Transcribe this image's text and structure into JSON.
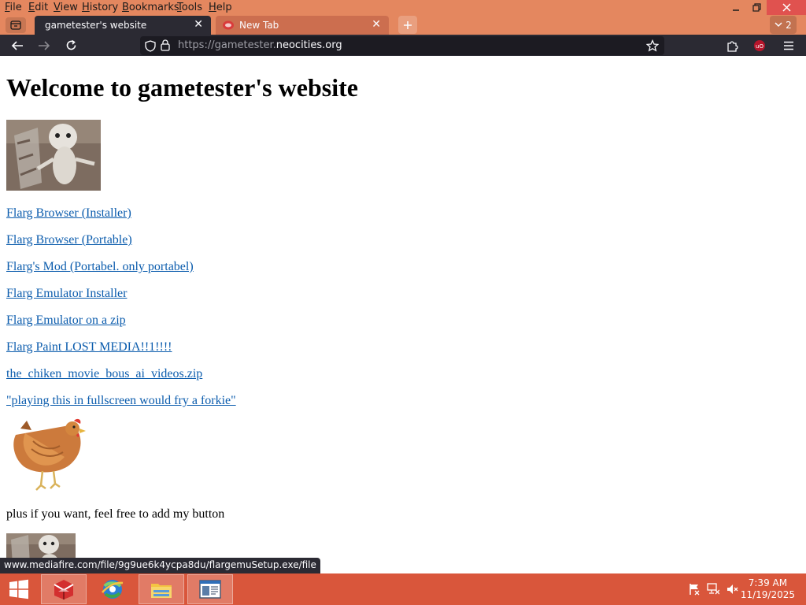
{
  "menubar": {
    "items": [
      "File",
      "Edit",
      "View",
      "History",
      "Bookmarks",
      "Tools",
      "Help"
    ]
  },
  "tabs": [
    {
      "label": "gametester's website",
      "active": true
    },
    {
      "label": "New Tab",
      "active": false
    }
  ],
  "tab_count": "2",
  "address_bar": {
    "prefix": "https://gametester.",
    "host": "neocities.org"
  },
  "page": {
    "heading": "Welcome to gametester's website",
    "links": [
      "Flarg Browser (Installer)",
      "Flarg Browser (Portable)",
      "Flarg's Mod (Portabel. only portabel)",
      "Flarg Emulator Installer",
      "Flarg Emulator on a zip",
      "Flarg Paint LOST MEDIA!!1!!!!",
      "the_chiken_movie_bous_ai_videos.zip",
      "\"playing this in fullscreen would fry a forkie\""
    ],
    "button_note": "plus if you want, feel free to add my button"
  },
  "status_url": "www.mediafire.com/file/9g9ue6k4ycpa8du/flargemuSetup.exe/file",
  "taskbar": {
    "time": "7:39 AM",
    "date": "11/19/2025"
  },
  "colors": {
    "accent": "#e4875f",
    "toolbar": "#2b2a33",
    "link": "#0b5cad",
    "taskbar": "#d9563b",
    "close": "#e0524f"
  }
}
